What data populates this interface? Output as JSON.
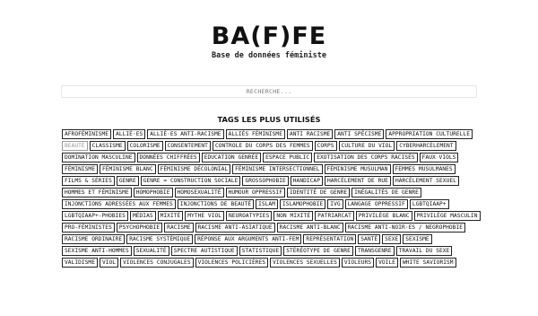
{
  "header": {
    "logo": "BA(F)FE",
    "subtitle": "Base de données féministe"
  },
  "search": {
    "placeholder": "RECHERCHE..."
  },
  "tags_section": {
    "title": "TAGS LES PLUS UTILISÉS",
    "tags": [
      {
        "label": "AFROFÉMINISME"
      },
      {
        "label": "ALLIÉ·ES"
      },
      {
        "label": "ALLIÉ·ES ANTI-RACISME"
      },
      {
        "label": "ALLIÉS FÉMINISME"
      },
      {
        "label": "ANTI RACISME"
      },
      {
        "label": "ANTI SPÉCISME"
      },
      {
        "label": "APPROPRIATION CULTURELLE"
      },
      {
        "label": "BEAUTÉ",
        "muted": true
      },
      {
        "label": "CLASSISME"
      },
      {
        "label": "COLORISME"
      },
      {
        "label": "CONSENTEMENT"
      },
      {
        "label": "CONTROLE DU CORPS DES FEMMES"
      },
      {
        "label": "CORPS"
      },
      {
        "label": "CULTURE DU VIOL"
      },
      {
        "label": "CYBERHARCÈLEMENT"
      },
      {
        "label": "DOMINATION MASCULINE"
      },
      {
        "label": "DONNÉES CHIFFRÉES"
      },
      {
        "label": "EDUCATION GENRÉE"
      },
      {
        "label": "ESPACE PUBLIC"
      },
      {
        "label": "EXOTISATION DES CORPS RACISÉS"
      },
      {
        "label": "FAUX VIOLS"
      },
      {
        "label": "FÉMINISME"
      },
      {
        "label": "FÉMINISME BLANC"
      },
      {
        "label": "FÉMINISME DÉCOLONIAL"
      },
      {
        "label": "FÉMINISME INTERSECTIONNEL"
      },
      {
        "label": "FÉMINISME MUSULMAN"
      },
      {
        "label": "FEMMES MUSULMANES"
      },
      {
        "label": "FILMS & SÉRIES"
      },
      {
        "label": "GENRE"
      },
      {
        "label": "GENRE = CONSTRUCTION SOCIALE"
      },
      {
        "label": "GROSSOPHOBIE"
      },
      {
        "label": "HANDICAP"
      },
      {
        "label": "HARCÈLEMENT DE RUE"
      },
      {
        "label": "HARCÈLEMENT SEXUEL"
      },
      {
        "label": "HOMMES ET FÉMINISME"
      },
      {
        "label": "HOMOPHOBIE"
      },
      {
        "label": "HOMOSEXUALITÉ"
      },
      {
        "label": "HUMOUR OPPRESSIF"
      },
      {
        "label": "IDENTITÉ DE GENRE"
      },
      {
        "label": "INÉGALITÉS DE GENRE"
      },
      {
        "label": "INJONCTIONS ADRESSÉES AUX FEMMES"
      },
      {
        "label": "INJONCTIONS DE BEAUTÉ"
      },
      {
        "label": "ISLAM"
      },
      {
        "label": "ISLAMOPHOBIE"
      },
      {
        "label": "IVG"
      },
      {
        "label": "LANGAGE OPPRESSIF"
      },
      {
        "label": "LGBTQIAAP+"
      },
      {
        "label": "LGBTQIAAP+-PHOBIES"
      },
      {
        "label": "MÉDIAS"
      },
      {
        "label": "MIXITÉ"
      },
      {
        "label": "MYTHE VIOL"
      },
      {
        "label": "NEUROATYPIES"
      },
      {
        "label": "NON MIXITÉ"
      },
      {
        "label": "PATRIARCAT"
      },
      {
        "label": "PRIVILÈGE BLANC"
      },
      {
        "label": "PRIVILÈGE MASCULIN"
      },
      {
        "label": "PRO-FÉMINISTES"
      },
      {
        "label": "PSYCHOPHOBIE"
      },
      {
        "label": "RACISME"
      },
      {
        "label": "RACISME ANTI-ASIATIQUE"
      },
      {
        "label": "RACISME ANTI-BLANC"
      },
      {
        "label": "RACISME ANTI-NOIR·ES / NEGROPHOBIE"
      },
      {
        "label": "RACISME ORDINAIRE"
      },
      {
        "label": "RACISME SYSTÉMIQUE"
      },
      {
        "label": "RÉPONSE AUX ARGUMENTS ANTI-FEM"
      },
      {
        "label": "REPRÉSENTATION"
      },
      {
        "label": "SANTÉ"
      },
      {
        "label": "SEXE"
      },
      {
        "label": "SEXISME"
      },
      {
        "label": "SEXISME ANTI-HOMMES"
      },
      {
        "label": "SEXUALITÉ"
      },
      {
        "label": "SPECTRE AUTISTIQUE"
      },
      {
        "label": "STATISTIQUE"
      },
      {
        "label": "STÉRÉOTYPE DE GENRE"
      },
      {
        "label": "TRANSGENRE"
      },
      {
        "label": "TRAVAIL DU SEXE"
      },
      {
        "label": "VALIDISME"
      },
      {
        "label": "VIOL"
      },
      {
        "label": "VIOLENCES CONJUGALES"
      },
      {
        "label": "VIOLENCES POLICIÈRES"
      },
      {
        "label": "VIOLENCES SEXUELLES"
      },
      {
        "label": "VIOLEURS"
      },
      {
        "label": "VOILE"
      },
      {
        "label": "WHITE SAVIORISM"
      }
    ]
  }
}
